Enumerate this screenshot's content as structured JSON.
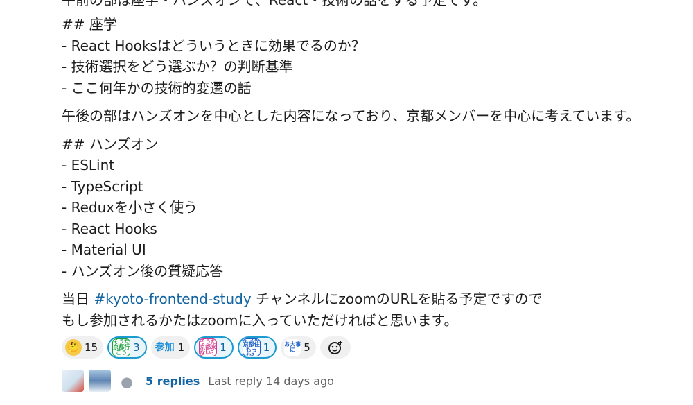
{
  "message": {
    "cut_top_line": "午前の部は座学・ハンズオンで、React・技術の話をする予定です。",
    "section1_heading": "## 座学",
    "section1_items": [
      "- React Hooksはどういうときに効果でるのか？",
      "- 技術選択をどう選ぶか？の判断基準",
      "- ここ何年かの技術的変遷の話"
    ],
    "afternoon_note": "午後の部はハンズオンを中心とした内容になっており、京都メンバーを中心に考えています。",
    "section2_heading": "## ハンズオン",
    "section2_items": [
      "- ESLint",
      "- TypeScript",
      "- Reduxを小さく使う",
      "- React Hooks",
      "- Material UI",
      "- ハンズオン後の質疑応答"
    ],
    "closing_prefix": "当日 ",
    "channel_link": "#kyoto-frontend-study",
    "closing_suffix": " チャンネルにzoomのURLを貼る予定ですので",
    "closing_line2": "もし参加されるかたはzoomに入っていただければと思います。"
  },
  "reactions": [
    {
      "icon": "thinking-face-icon",
      "label": "🤔",
      "count": "15",
      "mine": false
    },
    {
      "icon": "soudakyoto-ikou-icon",
      "label": "そうだ京都行こう",
      "count": "3",
      "mine": true
    },
    {
      "icon": "sanka-icon",
      "label": "参加",
      "count": "1",
      "mine": false
    },
    {
      "icon": "soudakyoto-konai-icon",
      "label": "そうだ京都来ない？",
      "count": "1",
      "mine": true
    },
    {
      "icon": "soudakyoto-sumokka-icon",
      "label": "そうだ京都住もっか？",
      "count": "1",
      "mine": true
    },
    {
      "icon": "odaijini-icon",
      "label": "お大事に",
      "count": "5",
      "mine": false
    }
  ],
  "add_reaction_icon": "add-reaction-icon",
  "thread": {
    "replies": "5 replies",
    "last_reply": "Last reply 14 days ago"
  },
  "colors": {
    "link": "#1264a3",
    "mine_border": "#1d9bd1",
    "mine_bg": "#e8f5fa"
  }
}
